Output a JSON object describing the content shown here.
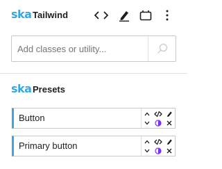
{
  "header": {
    "logo_text": "ska",
    "title": "Tailwind",
    "icons": [
      "code-icon",
      "pencil-icon",
      "panel-icon",
      "more-vertical-icon"
    ]
  },
  "search": {
    "placeholder": "Add classes or utility...",
    "value": ""
  },
  "presets": {
    "logo_text": "ska",
    "title": "Presets",
    "items": [
      {
        "name": "Button"
      },
      {
        "name": "Primary button"
      }
    ]
  },
  "colors": {
    "accent": "#3aa6e0",
    "contrast_icon": "#7b2ff7"
  }
}
